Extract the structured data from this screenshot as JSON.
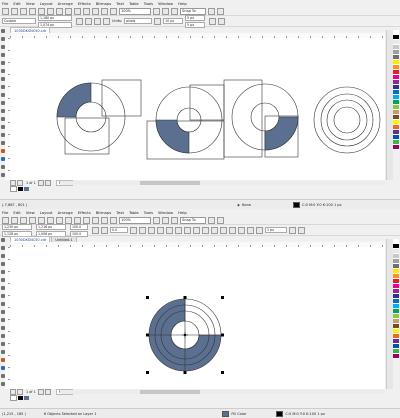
{
  "menu": [
    "File",
    "Edit",
    "View",
    "Layout",
    "Arrange",
    "Effects",
    "Bitmaps",
    "Text",
    "Table",
    "Tools",
    "Window",
    "Help"
  ],
  "toolbar": {
    "zoom": "100%",
    "snap_to": "Snap To"
  },
  "window1": {
    "propbar": {
      "preset": "Custom",
      "width": "1,180 px",
      "height": "1,074 px",
      "units_label": "Units:",
      "units": "pixels",
      "nudge": "10 px",
      "dup_x": "5 px",
      "dup_y": "5 px"
    },
    "tab": "1030DKSNC50.cdr",
    "page_nav": {
      "count": "1 of 1",
      "page": "Page 1"
    },
    "status": {
      "coords": "(-7,687 , 801 )",
      "fill": "None",
      "outline": "C:0 M:0 Y:0 K:100  1 px"
    }
  },
  "window2": {
    "propbar": {
      "x": "1,230 px",
      "y": "1,128 px",
      "w": "1,216 px",
      "h": "1,008 px",
      "scale_w": "100.0",
      "scale_h": "100.0",
      "angle": "0.0",
      "outline_width": "1 px"
    },
    "tabs": [
      "1030DKSNC50.cdr",
      "Untitled-1"
    ],
    "page_nav": {
      "count": "1 of 1",
      "page": "Page 1"
    },
    "status": {
      "coords": "(1,215 , 185 )",
      "selection": "6 Objects Selected on Layer 1",
      "fill": "Fill Color",
      "outline": "C:0 M:0 Y:0 K:100  1 px"
    }
  },
  "colors": {
    "shape_fill": "#5b7091",
    "palette": [
      "#ffffff",
      "#000000",
      "#e8e8e8",
      "#c8c8c8",
      "#9e9e9e",
      "#6e6e6e",
      "#ffe600",
      "#f7941d",
      "#ed1c24",
      "#ec008c",
      "#92278f",
      "#2e3192",
      "#0072bc",
      "#00aeef",
      "#00a651",
      "#8dc63f",
      "#c69c6d",
      "#754c24",
      "#fff200",
      "#f26522",
      "#662d91",
      "#0054a6",
      "#39b54a",
      "#9e005d"
    ]
  }
}
